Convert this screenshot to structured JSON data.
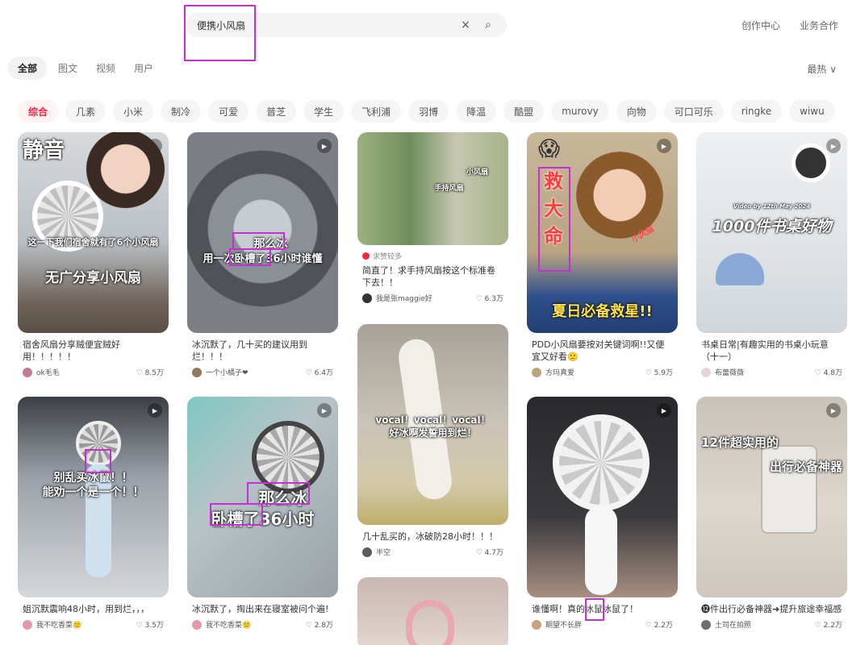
{
  "search": {
    "query": "便携小风扇",
    "clear_icon": "×",
    "search_icon": "⌕"
  },
  "topnav": {
    "creator": "创作中心",
    "business": "业务合作"
  },
  "tabs": [
    {
      "label": "全部"
    },
    {
      "label": "图文"
    },
    {
      "label": "视频"
    },
    {
      "label": "用户"
    }
  ],
  "sort": {
    "label": "最热 ∨"
  },
  "chips": [
    {
      "label": "综合"
    },
    {
      "label": "几素"
    },
    {
      "label": "小米"
    },
    {
      "label": "制冷"
    },
    {
      "label": "可爱"
    },
    {
      "label": "普芝"
    },
    {
      "label": "学生"
    },
    {
      "label": "飞利浦"
    },
    {
      "label": "羽博"
    },
    {
      "label": "降温"
    },
    {
      "label": "酷盟"
    },
    {
      "label": "murovy"
    },
    {
      "label": "向物"
    },
    {
      "label": "可口可乐"
    },
    {
      "label": "ringke"
    },
    {
      "label": "wiwu"
    }
  ],
  "cards": [
    {
      "img_text_1": "静音",
      "img_text_2": "这一下我们宿舍就有了6个小风扇",
      "img_text_3": "无广分享小风扇",
      "title": "宿舍风扇分享贼便宜贼好用！！！！！",
      "author": "ok毛毛",
      "likes": "♡ 8.5万",
      "color": "#c9cfd4"
    },
    {
      "img_text_1": "那么冰",
      "img_text_2": "用一次卧槽了36小时谁懂",
      "title": "冰沉默了，几十买的建议用到烂！！！",
      "author": "一个小橘子❤",
      "likes": "♡ 6.4万",
      "color": "#6f7378"
    },
    {
      "img_text_1": "小风扇",
      "img_text_2": "手持风扇",
      "tag": "求赞较多",
      "title": "简直了！求手持风扇按这个标准卷下去！！",
      "author": "我是张maggie好",
      "likes": "♡ 6.3万",
      "color": "#8aa07a"
    },
    {
      "img_text_1": "救大命",
      "img_text_2": "小风扇",
      "img_text_3": "夏日必备救星!!",
      "title": "PDD小风扇要按对关键词啊!!又便宜又好看🙂",
      "author": "方玛真爱",
      "likes": "♡ 5.9万",
      "color": "#b8a382"
    },
    {
      "img_text_1": "Video by 12th May 2024",
      "img_text_2": "1000件书桌好物",
      "title": "书桌日常|有趣实用的书桌小玩意（十一）",
      "author": "布蕾薇薇",
      "likes": "♡ 4.8万",
      "color": "#e4e7ea"
    },
    {
      "img_text_1": "别乱买冰鼠！！",
      "img_text_2": "能劝一个是一个！！",
      "title": "姐沉默震响48小时，用到烂，，，",
      "author": "我不吃香菜🙂",
      "likes": "♡ 3.5万",
      "color": "#8a93a0"
    },
    {
      "img_text_1": "那么冰",
      "img_text_2": "卧槽了36小时",
      "title": "冰沉默了，掏出来在寝室被问个遍!",
      "author": "我不吃香菜🙂",
      "likes": "♡ 2.8万",
      "color": "#9aa3a8"
    },
    {
      "img_text_1": "vocal！vocal！vocal！",
      "img_text_2": "好冰啊发誓用到烂！",
      "title": "几十乱买的，冰破防28小时！！！",
      "author": "半空",
      "likes": "♡ 4.7万",
      "color": "#b9b2a6"
    },
    {
      "img_text_1": "",
      "title": "谁懂啊！真的冰鼠冰鼠了！",
      "author": "期望不长胖",
      "likes": "♡ 2.2万",
      "color": "#3a3a3e"
    },
    {
      "img_text_1": "12件超实用的",
      "img_text_2": "出行必备神器",
      "title": "⓬件出行必备神器➜提升旅途幸福感",
      "author": "土司在拍照",
      "likes": "♡ 2.2万",
      "color": "#d9d4cc"
    },
    {
      "img_text_1": "",
      "color": "#d8c9c4"
    }
  ]
}
